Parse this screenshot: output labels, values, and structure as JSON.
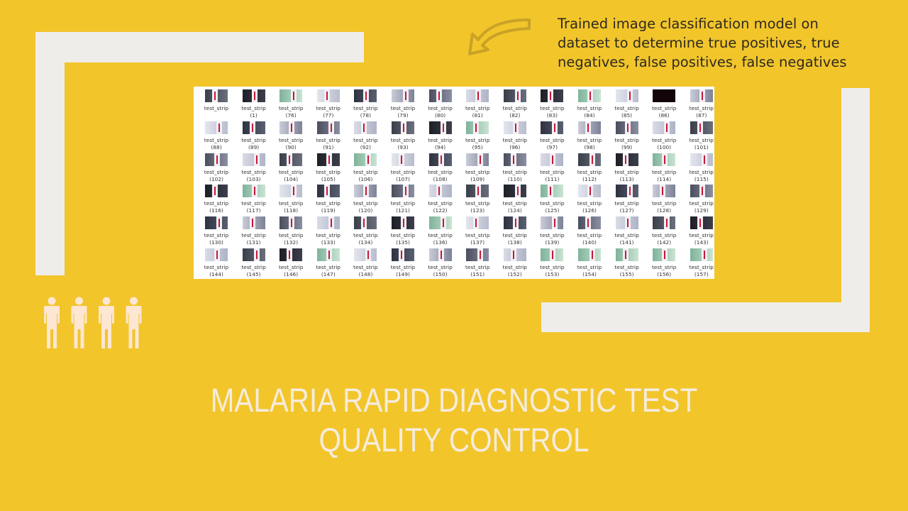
{
  "annotation": "Trained image classification model on dataset to determine true positives, true negatives, false positives, false negatives",
  "title": {
    "line1": "MALARIA RAPID DIAGNOSTIC TEST",
    "line2": "QUALITY CONTROL"
  },
  "icons": {
    "arrow": "curved-arrow-icon",
    "people": "people-icon"
  },
  "colors": {
    "background": "#f2c52b",
    "frame": "#efedea",
    "arrow": "#c9a227",
    "people": "#fde6d2",
    "title": "#f6ecdc"
  },
  "grid": {
    "caption": "test_strip",
    "tiles": [
      "",
      "(1)",
      "(76)",
      "(77)",
      "(78)",
      "(79)",
      "(80)",
      "(81)",
      "(82)",
      "(83)",
      "(84)",
      "(85)",
      "(86)",
      "(87)",
      "(88)",
      "(89)",
      "(90)",
      "(91)",
      "(92)",
      "(93)",
      "(94)",
      "(95)",
      "(96)",
      "(97)",
      "(98)",
      "(99)",
      "(100)",
      "(101)",
      "(102)",
      "(103)",
      "(104)",
      "(105)",
      "(106)",
      "(107)",
      "(108)",
      "(109)",
      "(110)",
      "(111)",
      "(112)",
      "(113)",
      "(114)",
      "(115)",
      "(116)",
      "(117)",
      "(118)",
      "(119)",
      "(120)",
      "(121)",
      "(122)",
      "(123)",
      "(124)",
      "(125)",
      "(126)",
      "(127)",
      "(128)",
      "(129)",
      "(130)",
      "(131)",
      "(132)",
      "(133)",
      "(134)",
      "(135)",
      "(136)",
      "(137)",
      "(138)",
      "(139)",
      "(140)",
      "(141)",
      "(142)",
      "(143)",
      "(144)",
      "(145)",
      "(146)",
      "(147)",
      "(148)",
      "(149)",
      "(150)",
      "(151)",
      "(152)",
      "(153)",
      "(154)",
      "(155)",
      "(156)",
      "(157)"
    ]
  }
}
